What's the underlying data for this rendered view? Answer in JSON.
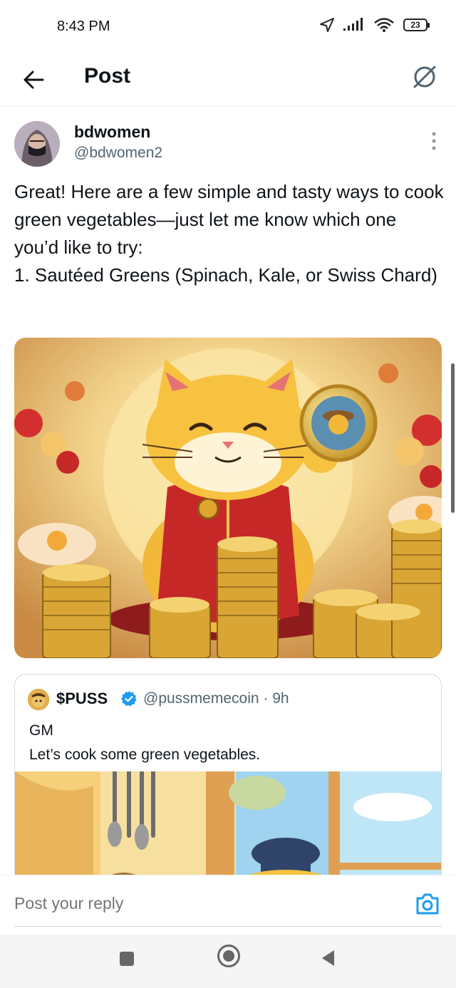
{
  "status_bar": {
    "time": "8:43 PM",
    "battery": "23"
  },
  "header": {
    "title": "Post"
  },
  "post": {
    "display_name": "bdwomen",
    "handle": "@bdwomen2",
    "text": "Great! Here are a few simple and tasty ways to cook green vegetables—just let me know which one you’d like to try:\n1. Sautéed Greens (Spinach, Kale, or Swiss Chard)"
  },
  "quote": {
    "display_name": "$PUSS",
    "handle_time": "@pussmemecoin · 9h",
    "text": "GM\nLet’s cook some green vegetables."
  },
  "reply": {
    "placeholder": "Post your reply"
  },
  "colors": {
    "accent": "#1d9bf0",
    "text": "#0f1419",
    "muted": "#536471"
  },
  "icons": [
    "back-arrow-icon",
    "grok-icon",
    "more-vertical-icon",
    "verified-icon",
    "camera-icon"
  ]
}
